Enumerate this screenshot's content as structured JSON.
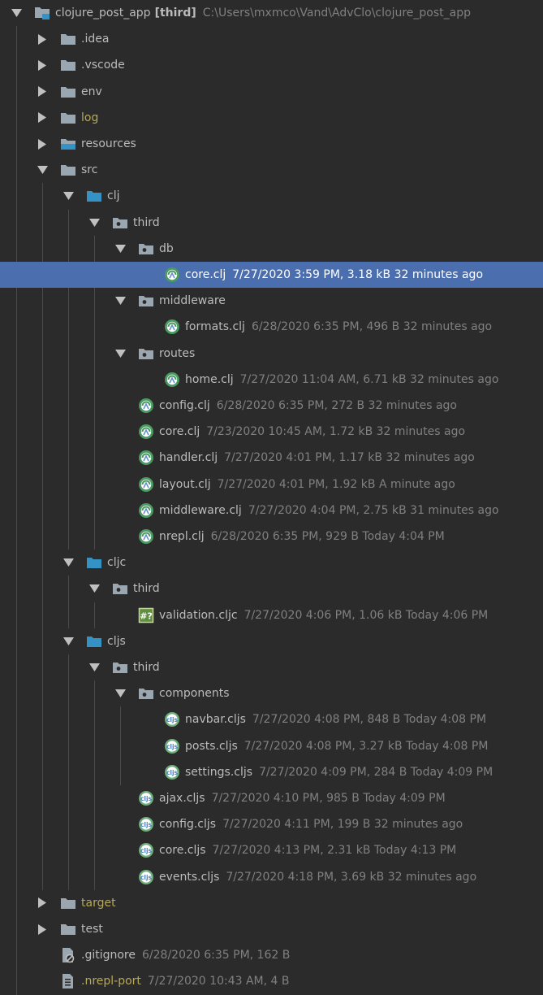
{
  "colors": {
    "background": "#2b2b2b",
    "selection": "#4b6eaf",
    "folder": "#9aa7b0",
    "source_folder": "#3592c4",
    "excluded_text": "#b5a95a",
    "clj_icon": "#4a9a62"
  },
  "rows": [
    {
      "level": 0,
      "arrow": "down",
      "icon": "module-folder-icon",
      "name": "clojure_post_app",
      "bold_suffix": "[third]",
      "extra": "C:\\Users\\mxmco\\Vand\\AdvClo\\clojure_post_app"
    },
    {
      "level": 1,
      "arrow": "right",
      "icon": "folder-icon",
      "name": ".idea"
    },
    {
      "level": 1,
      "arrow": "right",
      "icon": "folder-icon",
      "name": ".vscode"
    },
    {
      "level": 1,
      "arrow": "right",
      "icon": "folder-icon",
      "name": "env"
    },
    {
      "level": 1,
      "arrow": "right",
      "icon": "folder-icon",
      "name": "log",
      "yellow": true
    },
    {
      "level": 1,
      "arrow": "right",
      "icon": "resources-folder-icon",
      "name": "resources"
    },
    {
      "level": 1,
      "arrow": "down",
      "icon": "folder-icon",
      "name": "src"
    },
    {
      "level": 2,
      "arrow": "down",
      "icon": "source-folder-icon",
      "name": "clj"
    },
    {
      "level": 3,
      "arrow": "down",
      "icon": "package-icon",
      "name": "third"
    },
    {
      "level": 4,
      "arrow": "down",
      "icon": "package-icon",
      "name": "db"
    },
    {
      "level": 5,
      "arrow": "none",
      "icon": "clojure-file-icon",
      "name": "core.clj",
      "extra": "7/27/2020 3:59 PM, 3.18 kB 32 minutes ago",
      "selected": true
    },
    {
      "level": 4,
      "arrow": "down",
      "icon": "package-icon",
      "name": "middleware"
    },
    {
      "level": 5,
      "arrow": "none",
      "icon": "clojure-file-icon",
      "name": "formats.clj",
      "extra": "6/28/2020 6:35 PM, 496 B 32 minutes ago"
    },
    {
      "level": 4,
      "arrow": "down",
      "icon": "package-icon",
      "name": "routes"
    },
    {
      "level": 5,
      "arrow": "none",
      "icon": "clojure-file-icon",
      "name": "home.clj",
      "extra": "7/27/2020 11:04 AM, 6.71 kB 32 minutes ago"
    },
    {
      "level": 4,
      "arrow": "none",
      "icon": "clojure-file-icon",
      "name": "config.clj",
      "extra": "6/28/2020 6:35 PM, 272 B 32 minutes ago"
    },
    {
      "level": 4,
      "arrow": "none",
      "icon": "clojure-file-icon",
      "name": "core.clj",
      "extra": "7/23/2020 10:45 AM, 1.72 kB 32 minutes ago"
    },
    {
      "level": 4,
      "arrow": "none",
      "icon": "clojure-file-icon",
      "name": "handler.clj",
      "extra": "7/27/2020 4:01 PM, 1.17 kB 32 minutes ago"
    },
    {
      "level": 4,
      "arrow": "none",
      "icon": "clojure-file-icon",
      "name": "layout.clj",
      "extra": "7/27/2020 4:01 PM, 1.92 kB A minute ago"
    },
    {
      "level": 4,
      "arrow": "none",
      "icon": "clojure-file-icon",
      "name": "middleware.clj",
      "extra": "7/27/2020 4:04 PM, 2.75 kB 31 minutes ago"
    },
    {
      "level": 4,
      "arrow": "none",
      "icon": "clojure-file-icon",
      "name": "nrepl.clj",
      "extra": "6/28/2020 6:35 PM, 929 B Today 4:04 PM"
    },
    {
      "level": 2,
      "arrow": "down",
      "icon": "source-folder-icon",
      "name": "cljc"
    },
    {
      "level": 3,
      "arrow": "down",
      "icon": "package-icon",
      "name": "third"
    },
    {
      "level": 4,
      "arrow": "none",
      "icon": "unknown-file-icon",
      "name": "validation.cljc",
      "extra": "7/27/2020 4:06 PM, 1.06 kB Today 4:06 PM"
    },
    {
      "level": 2,
      "arrow": "down",
      "icon": "source-folder-icon",
      "name": "cljs"
    },
    {
      "level": 3,
      "arrow": "down",
      "icon": "package-icon",
      "name": "third"
    },
    {
      "level": 4,
      "arrow": "down",
      "icon": "package-icon",
      "name": "components"
    },
    {
      "level": 5,
      "arrow": "none",
      "icon": "clojurescript-file-icon",
      "name": "navbar.cljs",
      "extra": "7/27/2020 4:08 PM, 848 B Today 4:08 PM"
    },
    {
      "level": 5,
      "arrow": "none",
      "icon": "clojurescript-file-icon",
      "name": "posts.cljs",
      "extra": "7/27/2020 4:08 PM, 3.27 kB Today 4:08 PM"
    },
    {
      "level": 5,
      "arrow": "none",
      "icon": "clojurescript-file-icon",
      "name": "settings.cljs",
      "extra": "7/27/2020 4:09 PM, 284 B Today 4:09 PM"
    },
    {
      "level": 4,
      "arrow": "none",
      "icon": "clojurescript-file-icon",
      "name": "ajax.cljs",
      "extra": "7/27/2020 4:10 PM, 985 B Today 4:09 PM"
    },
    {
      "level": 4,
      "arrow": "none",
      "icon": "clojurescript-file-icon",
      "name": "config.cljs",
      "extra": "7/27/2020 4:11 PM, 199 B 32 minutes ago"
    },
    {
      "level": 4,
      "arrow": "none",
      "icon": "clojurescript-file-icon",
      "name": "core.cljs",
      "extra": "7/27/2020 4:13 PM, 2.31 kB Today 4:13 PM"
    },
    {
      "level": 4,
      "arrow": "none",
      "icon": "clojurescript-file-icon",
      "name": "events.cljs",
      "extra": "7/27/2020 4:18 PM, 3.69 kB 32 minutes ago"
    },
    {
      "level": 1,
      "arrow": "right",
      "icon": "folder-icon",
      "name": "target",
      "yellow": true
    },
    {
      "level": 1,
      "arrow": "right",
      "icon": "folder-icon",
      "name": "test"
    },
    {
      "level": 1,
      "arrow": "none",
      "icon": "ignore-file-icon",
      "name": ".gitignore",
      "extra": "6/28/2020 6:35 PM, 162 B"
    },
    {
      "level": 1,
      "arrow": "none",
      "icon": "text-file-icon",
      "name": ".nrepl-port",
      "extra": "7/27/2020 10:43 AM, 4 B",
      "yellow": true
    }
  ]
}
